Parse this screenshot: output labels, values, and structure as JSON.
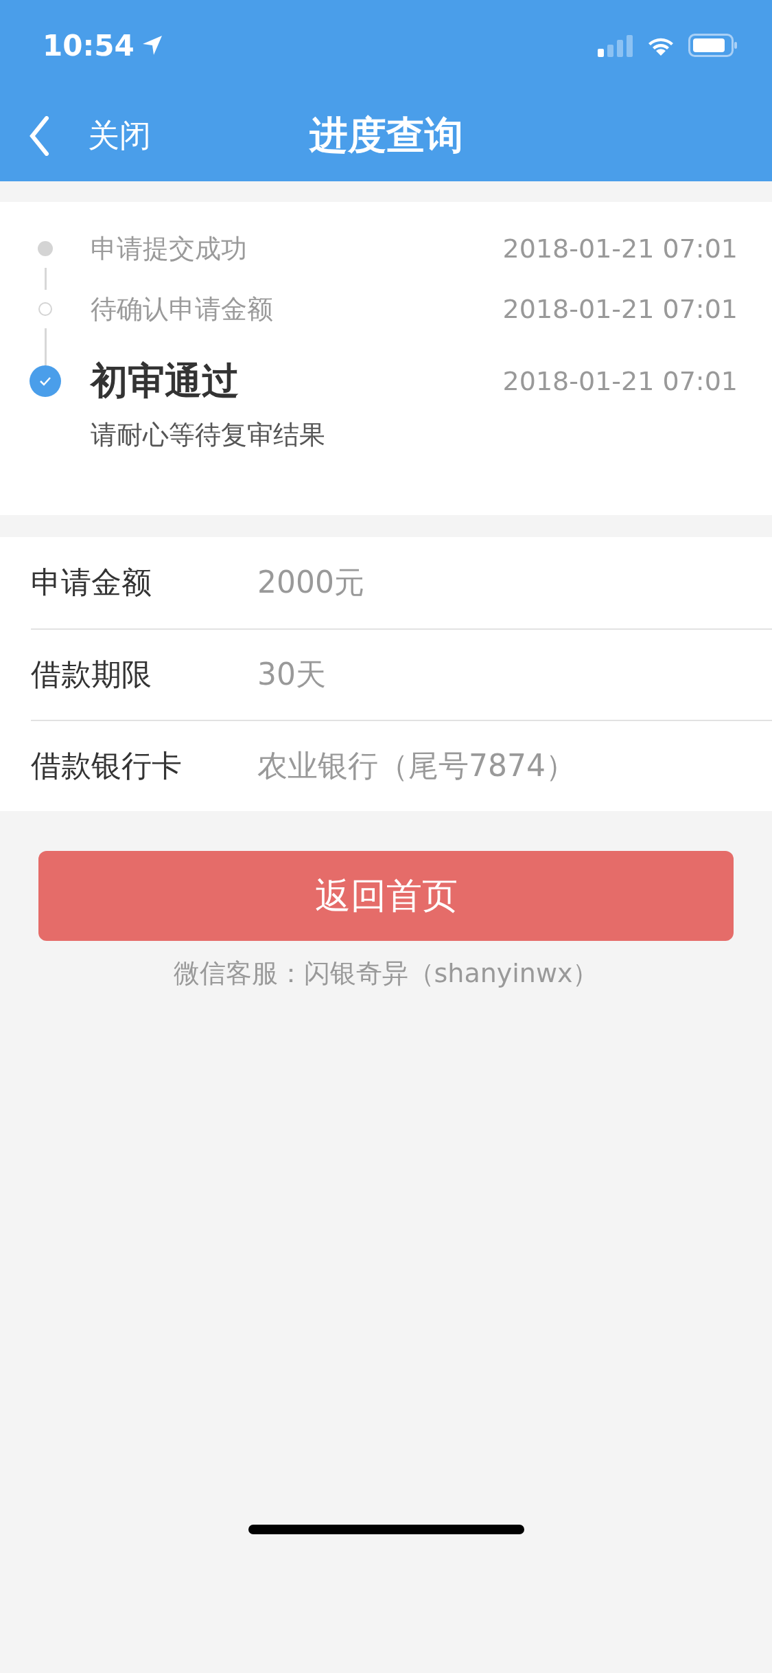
{
  "status_bar": {
    "time": "10:54"
  },
  "nav": {
    "back_label": "关闭",
    "title": "进度查询"
  },
  "timeline": [
    {
      "kind": "done",
      "label": "申请提交成功",
      "time": "2018-01-21 07:01"
    },
    {
      "kind": "pending",
      "label": "待确认申请金额",
      "time": "2018-01-21 07:01"
    },
    {
      "kind": "current",
      "label": "初审通过",
      "time": "2018-01-21 07:01",
      "note": "请耐心等待复审结果"
    }
  ],
  "details": [
    {
      "label": "申请金额",
      "value": "2000元"
    },
    {
      "label": "借款期限",
      "value": "30天"
    },
    {
      "label": "借款银行卡",
      "value": "农业银行（尾号7874）"
    }
  ],
  "button": "返回首页",
  "footer": "微信客服：闪银奇异（shanyinwx）"
}
